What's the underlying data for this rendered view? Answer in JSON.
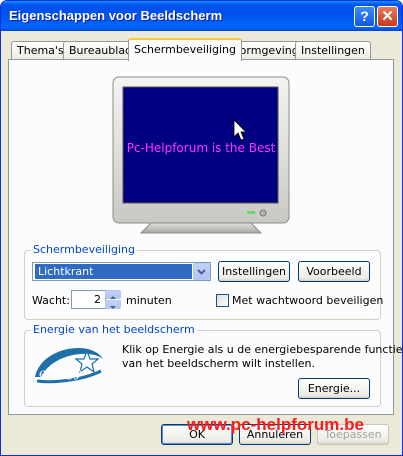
{
  "window": {
    "title": "Eigenschappen voor Beeldscherm",
    "help_glyph": "?",
    "close_glyph": "✕"
  },
  "tabs": [
    {
      "label": "Thema's"
    },
    {
      "label": "Bureaublad"
    },
    {
      "label": "Schermbeveiliging",
      "active": true
    },
    {
      "label": "Vormgeving"
    },
    {
      "label": "Instellingen"
    }
  ],
  "preview": {
    "text": "Pc-Helpforum is the Best",
    "screen_color": "#000080",
    "text_color": "#ff33ff"
  },
  "screensaver": {
    "group_label": "Schermbeveiliging",
    "selected": "Lichtkrant",
    "settings_label": "Instellingen",
    "preview_label": "Voorbeeld",
    "wait_label": "Wacht:",
    "wait_value": "2",
    "minutes_label": "minuten",
    "password_label": "Met wachtwoord beveiligen",
    "password_checked": false
  },
  "energy": {
    "group_label": "Energie van het beeldscherm",
    "description_line1": "Klik op Energie als u de energiebesparende functies",
    "description_line2": "van het beeldscherm wilt instellen.",
    "button_label": "Energie...",
    "logo_text": "energy"
  },
  "footer": {
    "ok_label": "OK",
    "cancel_label": "Annuleren",
    "apply_label": "Toepassen"
  },
  "watermark": "www.pc-helpforum.be"
}
